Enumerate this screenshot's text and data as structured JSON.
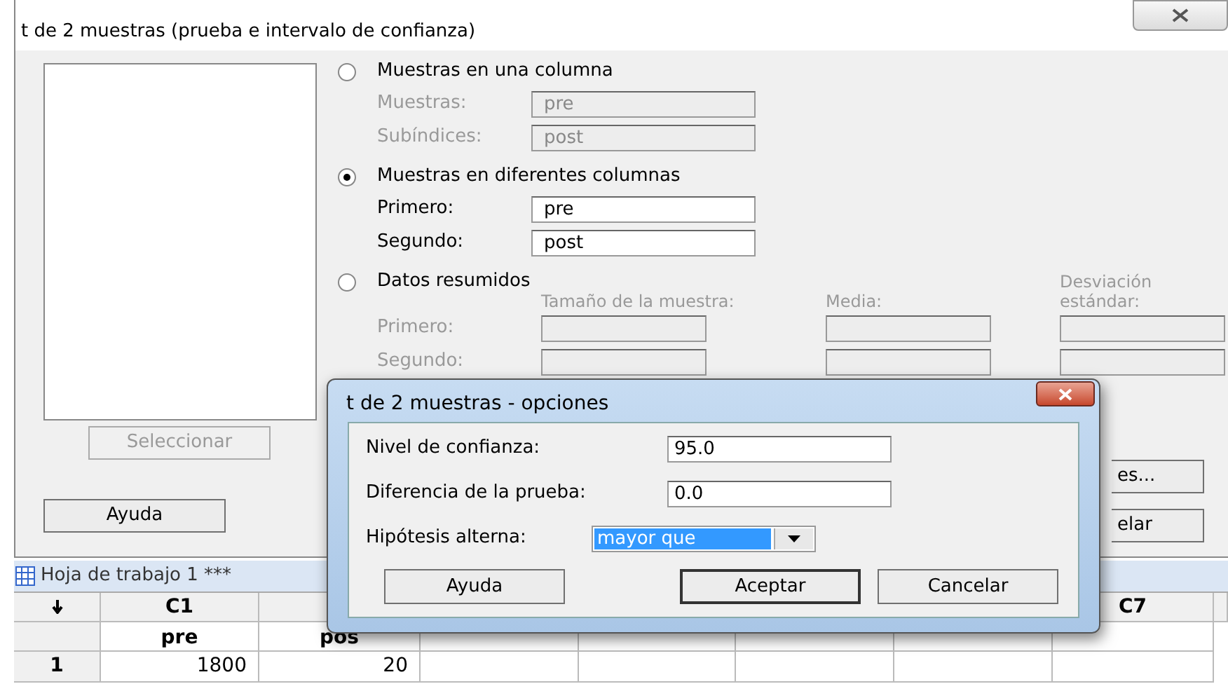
{
  "main_dialog": {
    "title": "t de 2 muestras (prueba e intervalo de confianza)",
    "options": [
      {
        "kind": "fields",
        "label": "Muestras en una columna",
        "selected": false,
        "fields": [
          {
            "label": "Muestras:",
            "value": "pre",
            "disabled": true
          },
          {
            "label": "Subíndices:",
            "value": "post",
            "disabled": true
          }
        ]
      },
      {
        "kind": "fields",
        "label": "Muestras en diferentes columnas",
        "selected": true,
        "fields": [
          {
            "label": "Primero:",
            "value": "pre",
            "disabled": false
          },
          {
            "label": "Segundo:",
            "value": "post",
            "disabled": false
          }
        ]
      },
      {
        "kind": "summary",
        "label": "Datos resumidos",
        "selected": false,
        "headers": [
          "Tamaño de la muestra:",
          "Media:",
          "Desviación estándar:"
        ],
        "rows": [
          "Primero:",
          "Segundo:"
        ],
        "disabled": true
      }
    ],
    "select_button": {
      "label": "Seleccionar",
      "disabled": true
    },
    "help_button": "Ayuda",
    "right_buttons": [
      "es...",
      "elar"
    ]
  },
  "worksheet": {
    "title": "Hoja de trabajo 1 ***",
    "columns": [
      {
        "id": "C1",
        "name": "pre",
        "values": [
          "1800"
        ]
      },
      {
        "name": "pos",
        "values": [
          "20"
        ]
      },
      {},
      {},
      {},
      {},
      {
        "id": "C7"
      }
    ],
    "rows": [
      "1"
    ]
  },
  "options_dialog": {
    "title": "t de 2 muestras - opciones",
    "fields": [
      {
        "label": "Nivel de confianza:",
        "value": "95.0"
      },
      {
        "label": "Diferencia de la prueba:",
        "value": "0.0"
      }
    ],
    "dropdown": {
      "label": "Hipótesis alterna:",
      "value": "mayor que"
    },
    "buttons": [
      {
        "label": "Ayuda",
        "default": false
      },
      {
        "label": "Aceptar",
        "default": true
      },
      {
        "label": "Cancelar",
        "default": false
      }
    ]
  }
}
